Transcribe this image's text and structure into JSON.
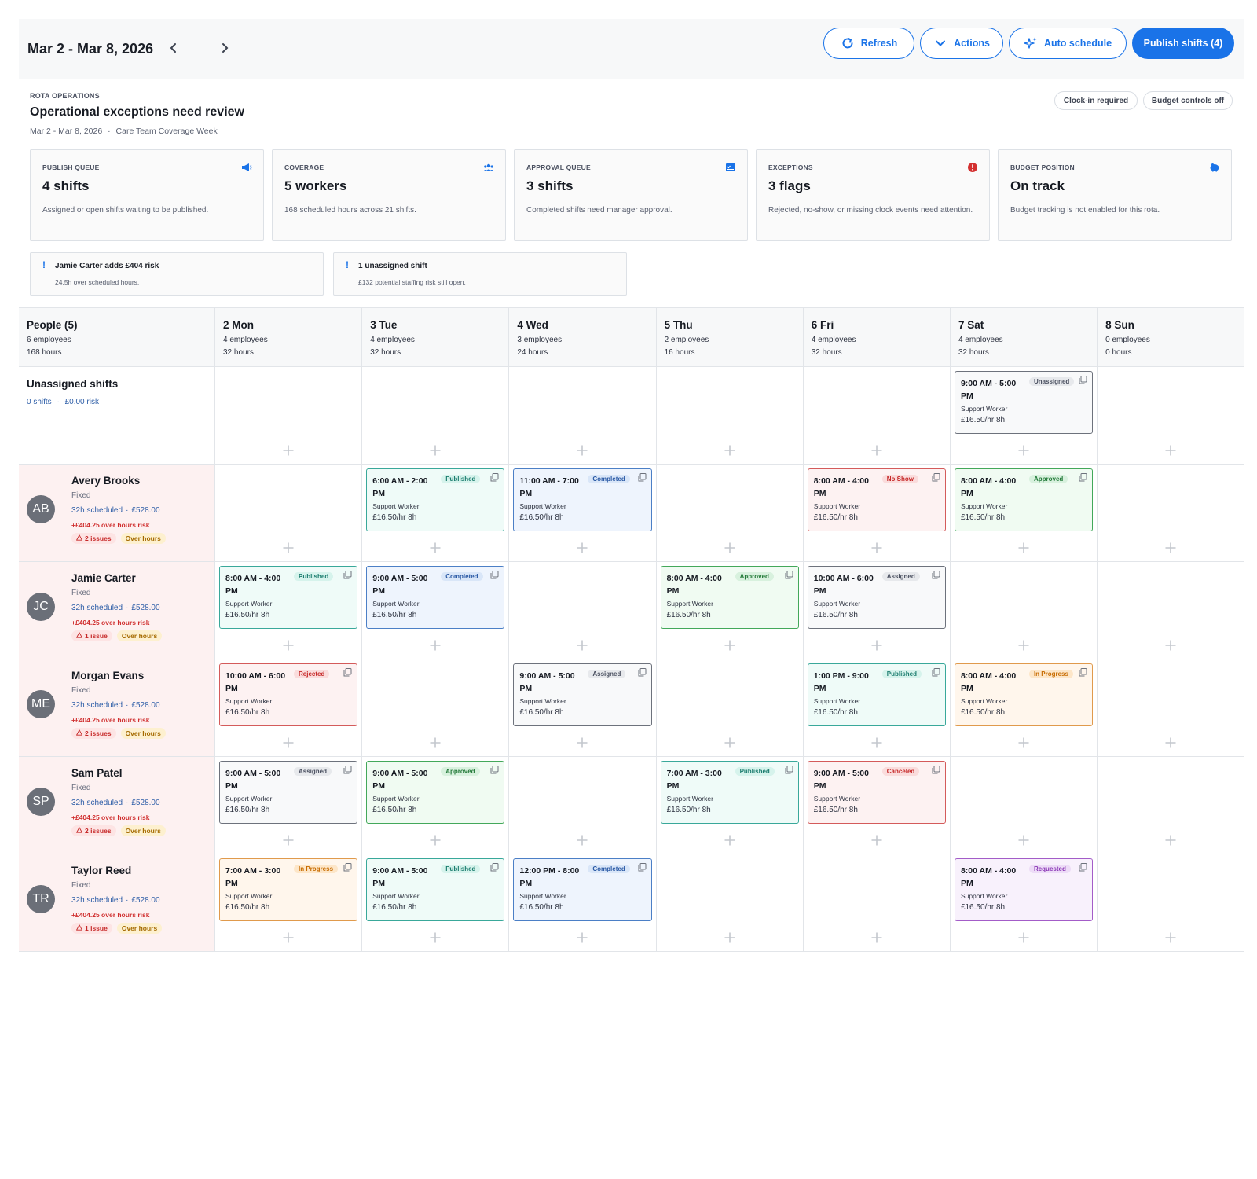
{
  "toolbar": {
    "range_title": "Mar 2 - Mar 8, 2026",
    "refresh_label": "Refresh",
    "actions_label": "Actions",
    "auto_schedule_label": "Auto schedule",
    "publish_label": "Publish shifts (4)",
    "accent": "#1a73e8"
  },
  "header": {
    "eyebrow": "ROTA OPERATIONS",
    "title": "Operational exceptions need review",
    "range": "Mar 2 - Mar 8, 2026",
    "separator": "·",
    "team": "Care Team Coverage Week",
    "pill_clock": "Clock-in required",
    "pill_budget": "Budget controls off"
  },
  "stats": [
    {
      "label": "PUBLISH QUEUE",
      "value": "4 shifts",
      "desc": "Assigned or open shifts waiting to be published.",
      "icon": "megaphone-icon"
    },
    {
      "label": "COVERAGE",
      "value": "5 workers",
      "desc": "168 scheduled hours across 21 shifts.",
      "icon": "people-icon"
    },
    {
      "label": "APPROVAL QUEUE",
      "value": "3 shifts",
      "desc": "Completed shifts need manager approval.",
      "icon": "checklist-icon"
    },
    {
      "label": "EXCEPTIONS",
      "value": "3 flags",
      "desc": "Rejected, no-show, or missing clock events need attention.",
      "icon": "alert-icon"
    },
    {
      "label": "BUDGET POSITION",
      "value": "On track",
      "desc": "Budget tracking is not enabled for this rota.",
      "icon": "piggy-bank-icon"
    }
  ],
  "alerts": [
    {
      "mark": "!",
      "title": "Jamie Carter adds £404 risk",
      "desc": "24.5h over scheduled hours."
    },
    {
      "mark": "!",
      "title": "1 unassigned shift",
      "desc": "£132 potential staffing risk still open."
    }
  ],
  "grid": {
    "people_title": "People (5)",
    "people_employees": "6 employees",
    "people_hours": "168 hours",
    "days": [
      {
        "title": "2 Mon",
        "employees": "4 employees",
        "hours": "32 hours"
      },
      {
        "title": "3 Tue",
        "employees": "4 employees",
        "hours": "32 hours"
      },
      {
        "title": "4 Wed",
        "employees": "3 employees",
        "hours": "24 hours"
      },
      {
        "title": "5 Thu",
        "employees": "2 employees",
        "hours": "16 hours"
      },
      {
        "title": "6 Fri",
        "employees": "4 employees",
        "hours": "32 hours"
      },
      {
        "title": "7 Sat",
        "employees": "4 employees",
        "hours": "32 hours"
      },
      {
        "title": "8 Sun",
        "employees": "0 employees",
        "hours": "0 hours"
      }
    ],
    "unassigned": {
      "title": "Unassigned shifts",
      "shifts": "0 shifts",
      "risk": "£0.00 risk",
      "shift": {
        "time": "9:00 AM - 5:00 PM",
        "status": "Unassigned",
        "role": "Support Worker",
        "rate": "£16.50/hr 8h"
      }
    },
    "employees": [
      {
        "initials": "AB",
        "name": "Avery Brooks",
        "type": "Fixed",
        "scheduled": "32h scheduled",
        "cost": "£528.00",
        "risk": "+£404.25 over hours risk",
        "issues": "2 issues",
        "over": "Over hours",
        "shifts": [
          null,
          {
            "time": "6:00 AM - 2:00 PM",
            "status": "Published",
            "role": "Support Worker",
            "rate": "£16.50/hr 8h"
          },
          {
            "time": "11:00 AM - 7:00 PM",
            "status": "Completed",
            "role": "Support Worker",
            "rate": "£16.50/hr 8h"
          },
          null,
          {
            "time": "8:00 AM - 4:00 PM",
            "status": "No Show",
            "role": "Support Worker",
            "rate": "£16.50/hr 8h"
          },
          {
            "time": "8:00 AM - 4:00 PM",
            "status": "Approved",
            "role": "Support Worker",
            "rate": "£16.50/hr 8h"
          },
          null
        ]
      },
      {
        "initials": "JC",
        "name": "Jamie Carter",
        "type": "Fixed",
        "scheduled": "32h scheduled",
        "cost": "£528.00",
        "risk": "+£404.25 over hours risk",
        "issues": "1 issue",
        "over": "Over hours",
        "shifts": [
          {
            "time": "8:00 AM - 4:00 PM",
            "status": "Published",
            "role": "Support Worker",
            "rate": "£16.50/hr 8h"
          },
          {
            "time": "9:00 AM - 5:00 PM",
            "status": "Completed",
            "role": "Support Worker",
            "rate": "£16.50/hr 8h"
          },
          null,
          {
            "time": "8:00 AM - 4:00 PM",
            "status": "Approved",
            "role": "Support Worker",
            "rate": "£16.50/hr 8h"
          },
          {
            "time": "10:00 AM - 6:00 PM",
            "status": "Assigned",
            "role": "Support Worker",
            "rate": "£16.50/hr 8h"
          },
          null,
          null
        ]
      },
      {
        "initials": "ME",
        "name": "Morgan Evans",
        "type": "Fixed",
        "scheduled": "32h scheduled",
        "cost": "£528.00",
        "risk": "+£404.25 over hours risk",
        "issues": "2 issues",
        "over": "Over hours",
        "shifts": [
          {
            "time": "10:00 AM - 6:00 PM",
            "status": "Rejected",
            "role": "Support Worker",
            "rate": "£16.50/hr 8h"
          },
          null,
          {
            "time": "9:00 AM - 5:00 PM",
            "status": "Assigned",
            "role": "Support Worker",
            "rate": "£16.50/hr 8h"
          },
          null,
          {
            "time": "1:00 PM - 9:00 PM",
            "status": "Published",
            "role": "Support Worker",
            "rate": "£16.50/hr 8h"
          },
          {
            "time": "8:00 AM - 4:00 PM",
            "status": "In Progress",
            "role": "Support Worker",
            "rate": "£16.50/hr 8h"
          },
          null
        ]
      },
      {
        "initials": "SP",
        "name": "Sam Patel",
        "type": "Fixed",
        "scheduled": "32h scheduled",
        "cost": "£528.00",
        "risk": "+£404.25 over hours risk",
        "issues": "2 issues",
        "over": "Over hours",
        "shifts": [
          {
            "time": "9:00 AM - 5:00 PM",
            "status": "Assigned",
            "role": "Support Worker",
            "rate": "£16.50/hr 8h"
          },
          {
            "time": "9:00 AM - 5:00 PM",
            "status": "Approved",
            "role": "Support Worker",
            "rate": "£16.50/hr 8h"
          },
          null,
          {
            "time": "7:00 AM - 3:00 PM",
            "status": "Published",
            "role": "Support Worker",
            "rate": "£16.50/hr 8h"
          },
          {
            "time": "9:00 AM - 5:00 PM",
            "status": "Canceled",
            "role": "Support Worker",
            "rate": "£16.50/hr 8h"
          },
          null,
          null
        ]
      },
      {
        "initials": "TR",
        "name": "Taylor Reed",
        "type": "Fixed",
        "scheduled": "32h scheduled",
        "cost": "£528.00",
        "risk": "+£404.25 over hours risk",
        "issues": "1 issue",
        "over": "Over hours",
        "shifts": [
          {
            "time": "7:00 AM - 3:00 PM",
            "status": "In Progress",
            "role": "Support Worker",
            "rate": "£16.50/hr 8h"
          },
          {
            "time": "9:00 AM - 5:00 PM",
            "status": "Published",
            "role": "Support Worker",
            "rate": "£16.50/hr 8h"
          },
          {
            "time": "12:00 PM - 8:00 PM",
            "status": "Completed",
            "role": "Support Worker",
            "rate": "£16.50/hr 8h"
          },
          null,
          null,
          {
            "time": "8:00 AM - 4:00 PM",
            "status": "Requested",
            "role": "Support Worker",
            "rate": "£16.50/hr 8h"
          },
          null
        ]
      }
    ]
  }
}
